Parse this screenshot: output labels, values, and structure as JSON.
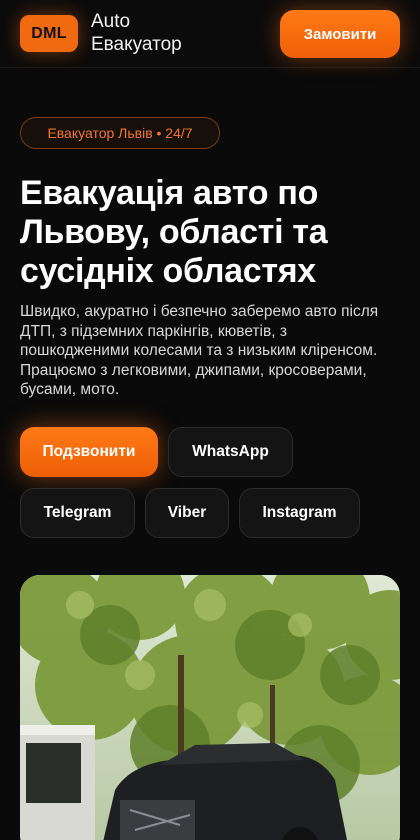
{
  "header": {
    "logo_badge": "DML",
    "logo_line1": "Auto",
    "logo_line2": "Евакуатор",
    "order_button": "Замовити"
  },
  "hero": {
    "tag": "Евакуатор Львів • 24/7",
    "title": "Евакуація авто по Львову, області та сусідніх областях",
    "description": "Швидко, акуратно і безпечно заберемо авто після ДТП, з підземних паркінгів, кюветів, з пошкодженими колесами та з низьким кліренсом. Працюємо з легковими, джипами, кросоверами, бусами, мото."
  },
  "contact_buttons": {
    "call": "Подзвонити",
    "whatsapp": "WhatsApp",
    "telegram": "Telegram",
    "viber": "Viber",
    "instagram": "Instagram"
  },
  "colors": {
    "accent": "#f26a0f",
    "background": "#0a0a0a",
    "button_dark": "#141414"
  }
}
